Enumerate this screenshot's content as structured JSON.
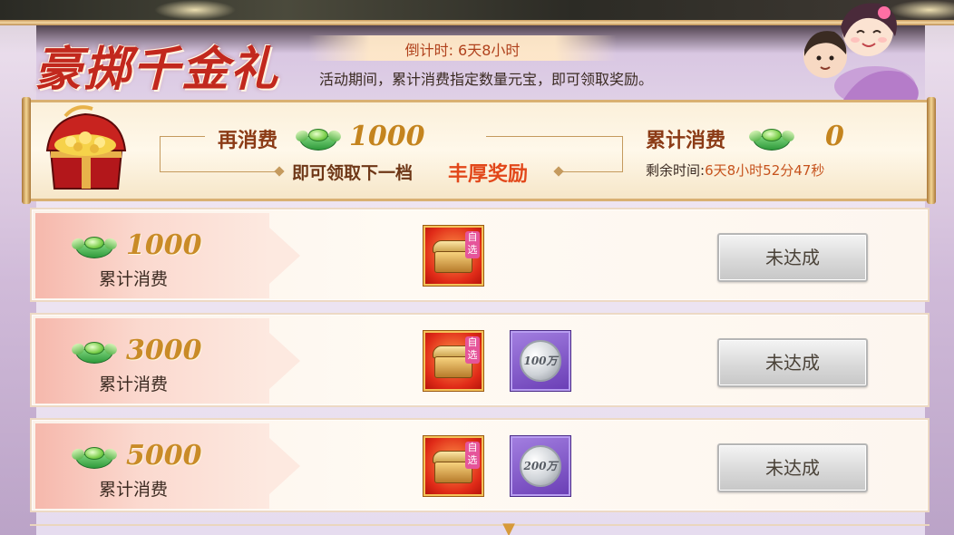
{
  "header": {
    "title": "豪掷千金礼",
    "countdown": "倒计时: 6天8小时",
    "description": "活动期间，累计消费指定数量元宝，即可领取奖励。"
  },
  "summary": {
    "spend_more_label": "再消费",
    "spend_more_value": "1000",
    "next_tier_text": "即可领取下一档",
    "next_tier_highlight": "丰厚奖励",
    "total_spent_label": "累计消费",
    "total_spent_value": "0",
    "remaining_label": "剩余时间:",
    "remaining_value": "6天8小时52分47秒"
  },
  "tiers": [
    {
      "amount": "1000",
      "label": "累计消费",
      "items": [
        {
          "type": "chest",
          "badge": "自选"
        }
      ],
      "button": "未达成"
    },
    {
      "amount": "3000",
      "label": "累计消费",
      "items": [
        {
          "type": "chest",
          "badge": "自选"
        },
        {
          "type": "coin",
          "amount": "100万"
        }
      ],
      "button": "未达成"
    },
    {
      "amount": "5000",
      "label": "累计消费",
      "items": [
        {
          "type": "chest",
          "badge": "自选"
        },
        {
          "type": "coin",
          "amount": "200万"
        }
      ],
      "button": "未达成"
    }
  ],
  "colors": {
    "title_red": "#c2281d",
    "amount_gold": "#c98b27",
    "ingot_green": "#3a9a2e",
    "coin_purple": "#6b3fb6",
    "button_gray": "#d7d7d7"
  },
  "icons": {
    "currency": "yuanbao-ingot-icon",
    "treasure": "treasure-chest-icon",
    "scroll": "chevron-down-icon"
  }
}
